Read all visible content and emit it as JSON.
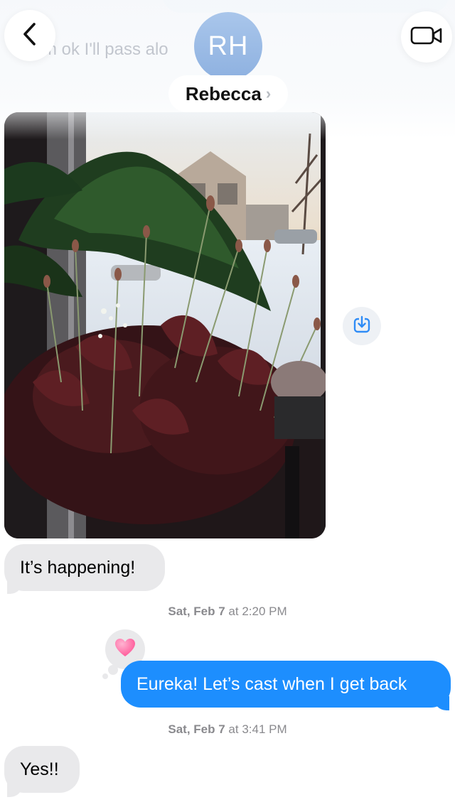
{
  "header": {
    "ghost_preview": "m ok I'll pass alo",
    "avatar_initials": "RH",
    "contact_name": "Rebecca",
    "chevron": "›",
    "back_icon": "chevron-left-icon",
    "video_icon": "video-camera-icon"
  },
  "messages": [
    {
      "id": "photo",
      "direction": "incoming",
      "type": "image",
      "content": "photo of plants in a window"
    },
    {
      "id": "m1",
      "direction": "incoming",
      "text": "It’s happening!"
    },
    {
      "id": "ts1",
      "type": "timestamp",
      "day": "Sat, Feb 7",
      "at": "at",
      "time": "2:20 PM"
    },
    {
      "id": "m2",
      "direction": "outgoing",
      "text": "Eureka! Let’s cast when I get back",
      "reaction": "heart"
    },
    {
      "id": "ts2",
      "type": "timestamp",
      "day": "Sat, Feb 7",
      "at": "at",
      "time": "3:41 PM"
    },
    {
      "id": "m3",
      "direction": "incoming",
      "text": "Yes!!"
    }
  ],
  "colors": {
    "outgoing_bubble": "#1d8efe",
    "incoming_bubble": "#e9e9eb",
    "avatar": "#9bbce6",
    "timestamp": "#8a8a8e",
    "reaction_heart": "#ff6fa6"
  }
}
